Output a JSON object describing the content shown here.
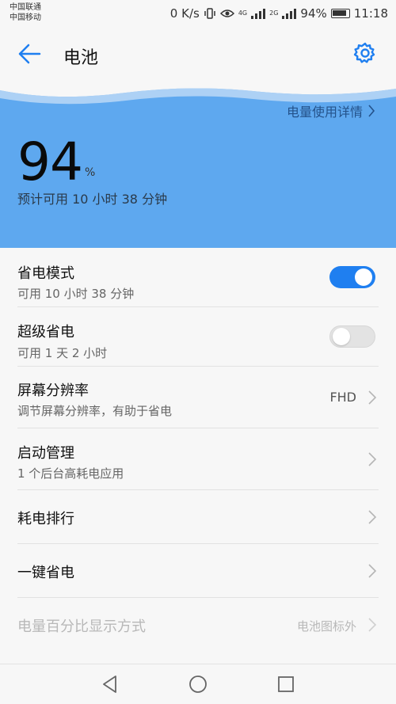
{
  "status_bar": {
    "carrier_1": "中国联通",
    "carrier_2": "中国移动",
    "net_speed": "0 K/s",
    "sim1_label": "4G",
    "sim2_label": "2G",
    "battery_text": "94%",
    "time": "11:18"
  },
  "app_bar": {
    "title": "电池"
  },
  "hero": {
    "usage_link": "电量使用详情",
    "percent": "94",
    "percent_unit": "%",
    "estimate": "预计可用 10 小时 38 分钟"
  },
  "settings": [
    {
      "title": "省电模式",
      "subtitle": "可用 10 小时 38 分钟",
      "control": "toggle",
      "on": true
    },
    {
      "title": "超级省电",
      "subtitle": "可用 1 天 2 小时",
      "control": "toggle",
      "on": false
    },
    {
      "title": "屏幕分辨率",
      "subtitle": "调节屏幕分辨率，有助于省电",
      "control": "chevron",
      "value": "FHD"
    },
    {
      "title": "启动管理",
      "subtitle": "1 个后台高耗电应用",
      "control": "chevron"
    },
    {
      "title": "耗电排行",
      "control": "chevron"
    },
    {
      "title": "一键省电",
      "control": "chevron"
    },
    {
      "title": "电量百分比显示方式",
      "control": "chevron",
      "value": "电池图标外",
      "disabled": true
    }
  ],
  "colors": {
    "accent": "#1f7ff0",
    "hero_bg": "#5ea8ef",
    "link_text": "#24528a"
  },
  "icons": {
    "back": "arrow-left-icon",
    "settings": "gear-icon",
    "nav_back": "triangle-back-icon",
    "nav_home": "circle-home-icon",
    "nav_recent": "square-recent-icon"
  }
}
